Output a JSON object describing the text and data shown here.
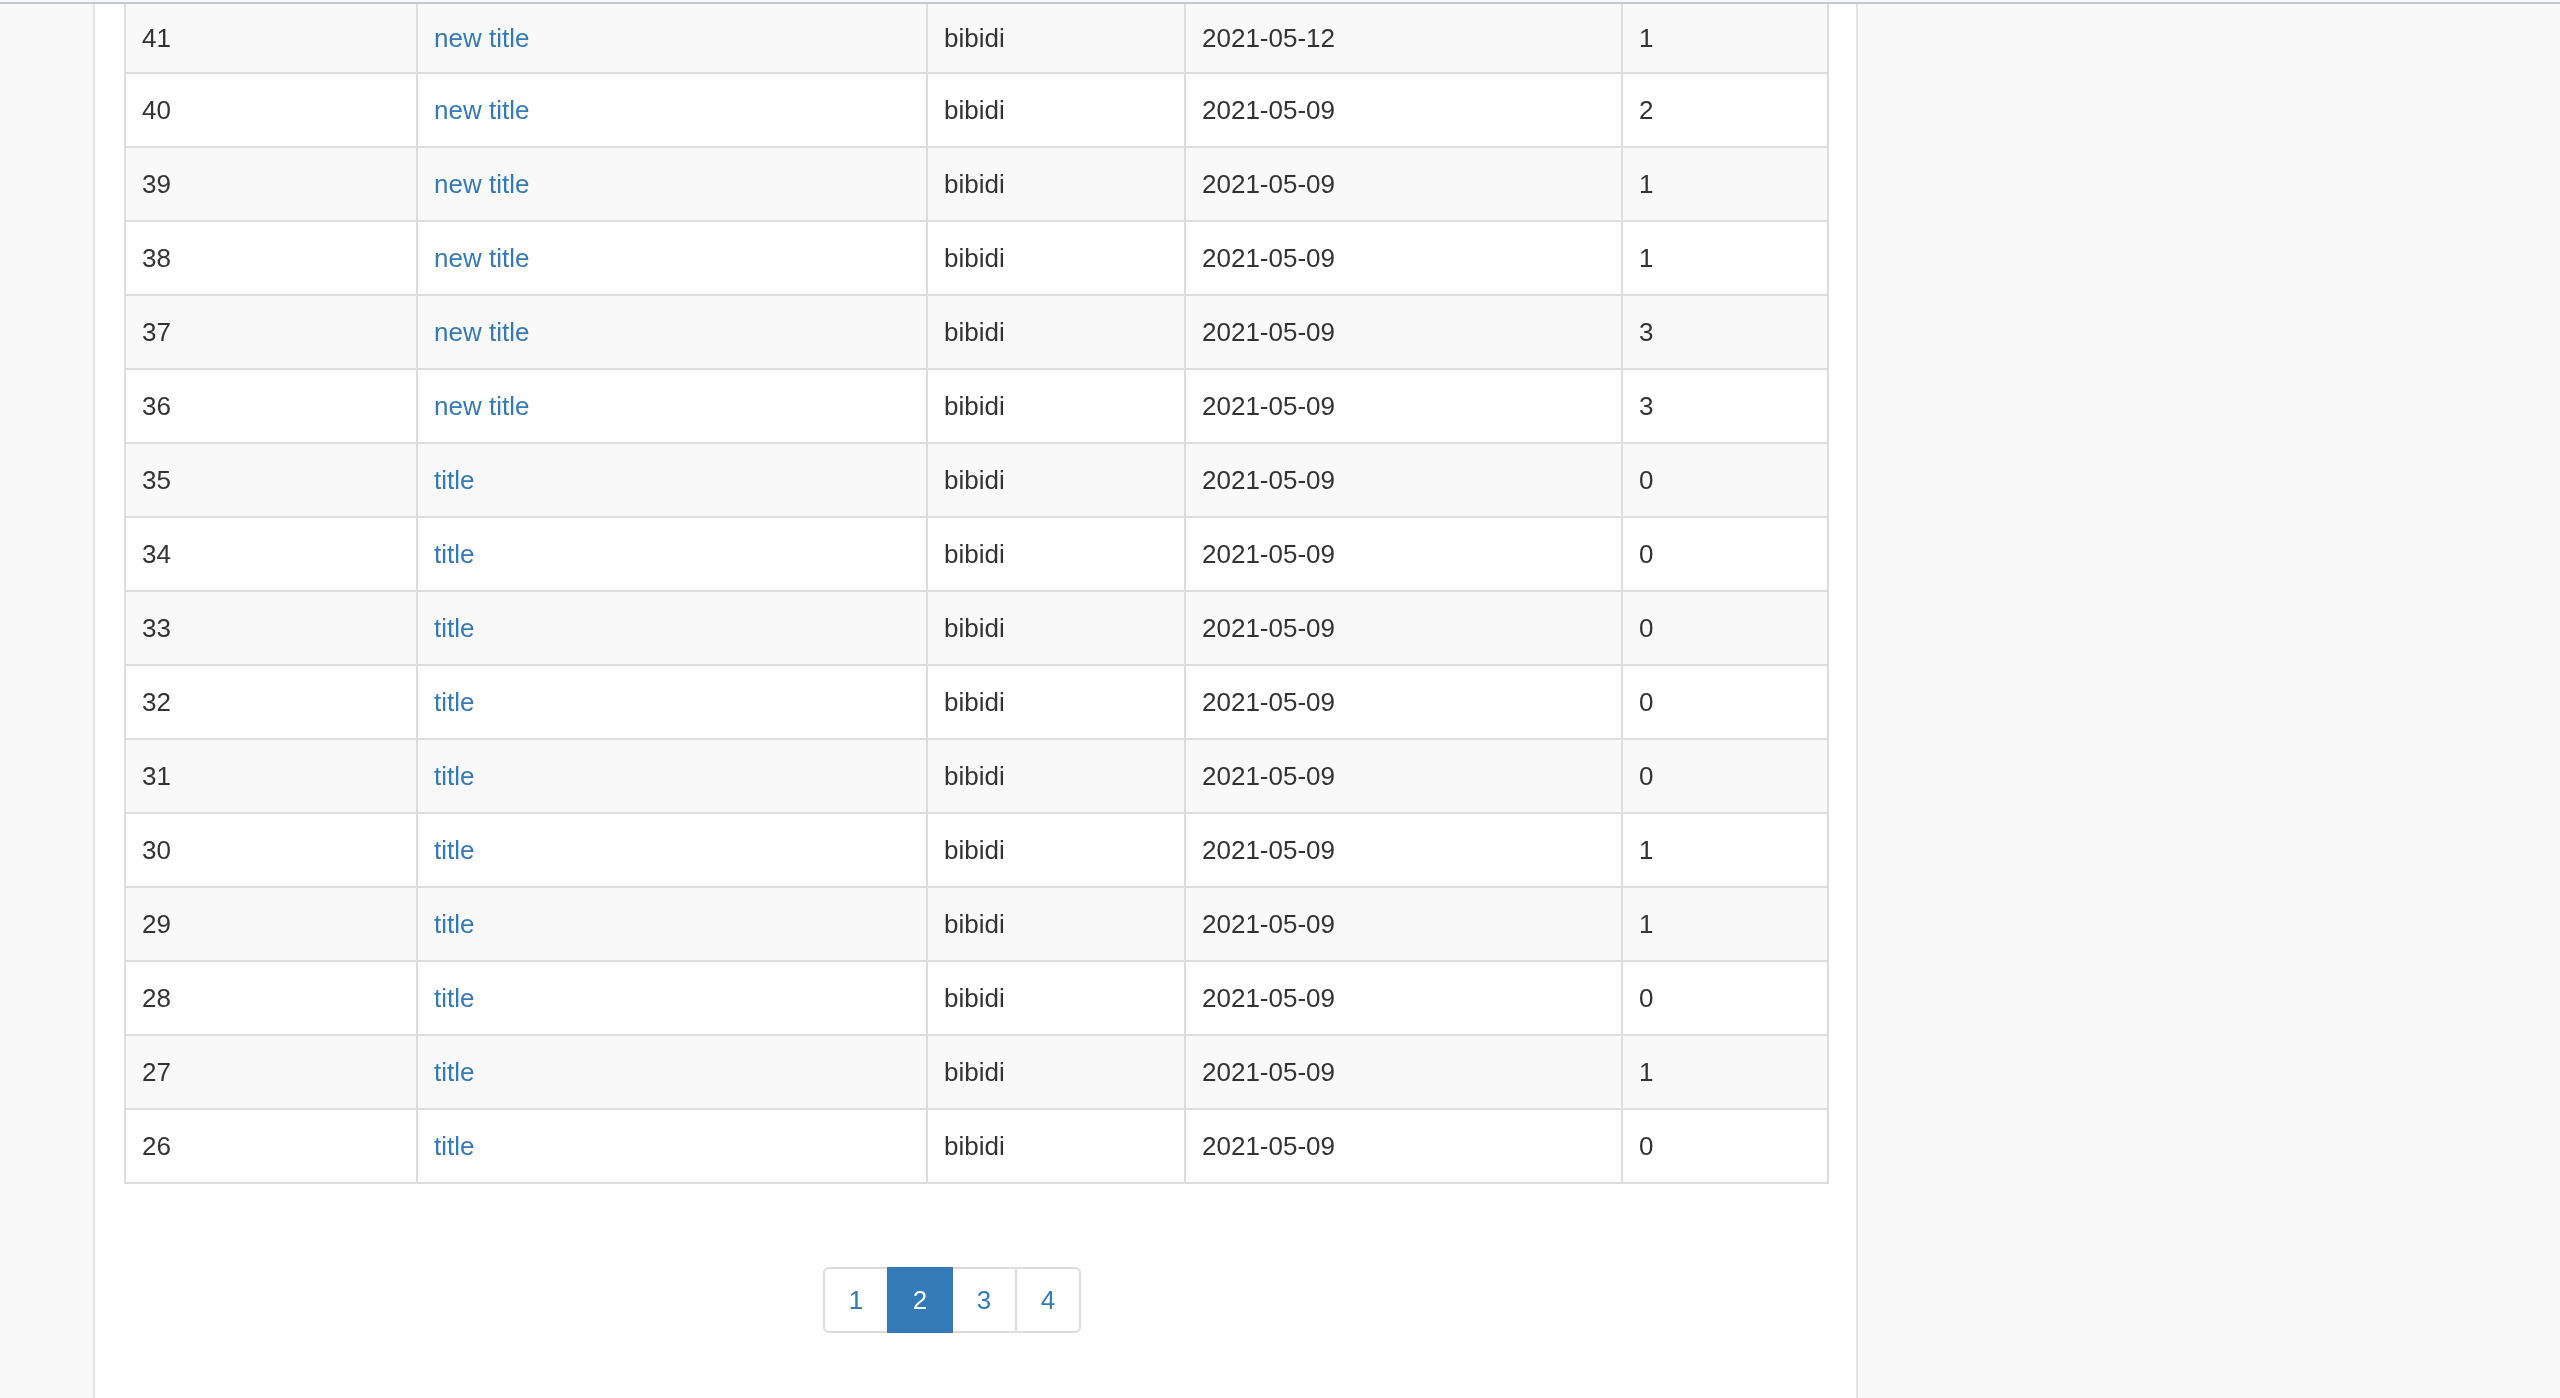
{
  "table": {
    "rows": [
      {
        "id": "41",
        "title": "new title",
        "author": "bibidi",
        "date": "2021-05-12",
        "count": "1"
      },
      {
        "id": "40",
        "title": "new title",
        "author": "bibidi",
        "date": "2021-05-09",
        "count": "2"
      },
      {
        "id": "39",
        "title": "new title",
        "author": "bibidi",
        "date": "2021-05-09",
        "count": "1"
      },
      {
        "id": "38",
        "title": "new title",
        "author": "bibidi",
        "date": "2021-05-09",
        "count": "1"
      },
      {
        "id": "37",
        "title": "new title",
        "author": "bibidi",
        "date": "2021-05-09",
        "count": "3"
      },
      {
        "id": "36",
        "title": "new title",
        "author": "bibidi",
        "date": "2021-05-09",
        "count": "3"
      },
      {
        "id": "35",
        "title": "title",
        "author": "bibidi",
        "date": "2021-05-09",
        "count": "0"
      },
      {
        "id": "34",
        "title": "title",
        "author": "bibidi",
        "date": "2021-05-09",
        "count": "0"
      },
      {
        "id": "33",
        "title": "title",
        "author": "bibidi",
        "date": "2021-05-09",
        "count": "0"
      },
      {
        "id": "32",
        "title": "title",
        "author": "bibidi",
        "date": "2021-05-09",
        "count": "0"
      },
      {
        "id": "31",
        "title": "title",
        "author": "bibidi",
        "date": "2021-05-09",
        "count": "0"
      },
      {
        "id": "30",
        "title": "title",
        "author": "bibidi",
        "date": "2021-05-09",
        "count": "1"
      },
      {
        "id": "29",
        "title": "title",
        "author": "bibidi",
        "date": "2021-05-09",
        "count": "1"
      },
      {
        "id": "28",
        "title": "title",
        "author": "bibidi",
        "date": "2021-05-09",
        "count": "0"
      },
      {
        "id": "27",
        "title": "title",
        "author": "bibidi",
        "date": "2021-05-09",
        "count": "1"
      },
      {
        "id": "26",
        "title": "title",
        "author": "bibidi",
        "date": "2021-05-09",
        "count": "0"
      }
    ]
  },
  "pagination": [
    {
      "label": "1",
      "selected": false
    },
    {
      "label": "2",
      "selected": true
    },
    {
      "label": "3",
      "selected": false
    },
    {
      "label": "4",
      "selected": false
    }
  ]
}
